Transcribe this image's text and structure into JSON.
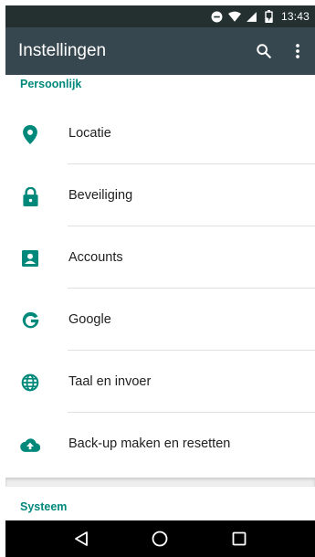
{
  "status_bar": {
    "time": "13:43",
    "icons": [
      "do-not-disturb-icon",
      "wifi-icon",
      "signal-icon",
      "battery-icon"
    ]
  },
  "app_bar": {
    "title": "Instellingen",
    "actions": [
      "search-icon",
      "more-vert-icon"
    ]
  },
  "sections": {
    "personal": "Persoonlijk",
    "system": "Systeem"
  },
  "items": [
    {
      "label": "Locatie",
      "icon": "location-pin-icon"
    },
    {
      "label": "Beveiliging",
      "icon": "lock-icon"
    },
    {
      "label": "Accounts",
      "icon": "account-box-icon"
    },
    {
      "label": "Google",
      "icon": "google-icon"
    },
    {
      "label": "Taal en invoer",
      "icon": "globe-icon"
    },
    {
      "label": "Back-up maken en resetten",
      "icon": "cloud-upload-icon"
    }
  ],
  "colors": {
    "accent": "#00897b",
    "app_bar": "#37474f",
    "status_bar": "#23302f",
    "nav_bar": "#000000"
  },
  "nav_bar": {
    "buttons": [
      "back-icon",
      "home-icon",
      "recents-icon"
    ]
  }
}
